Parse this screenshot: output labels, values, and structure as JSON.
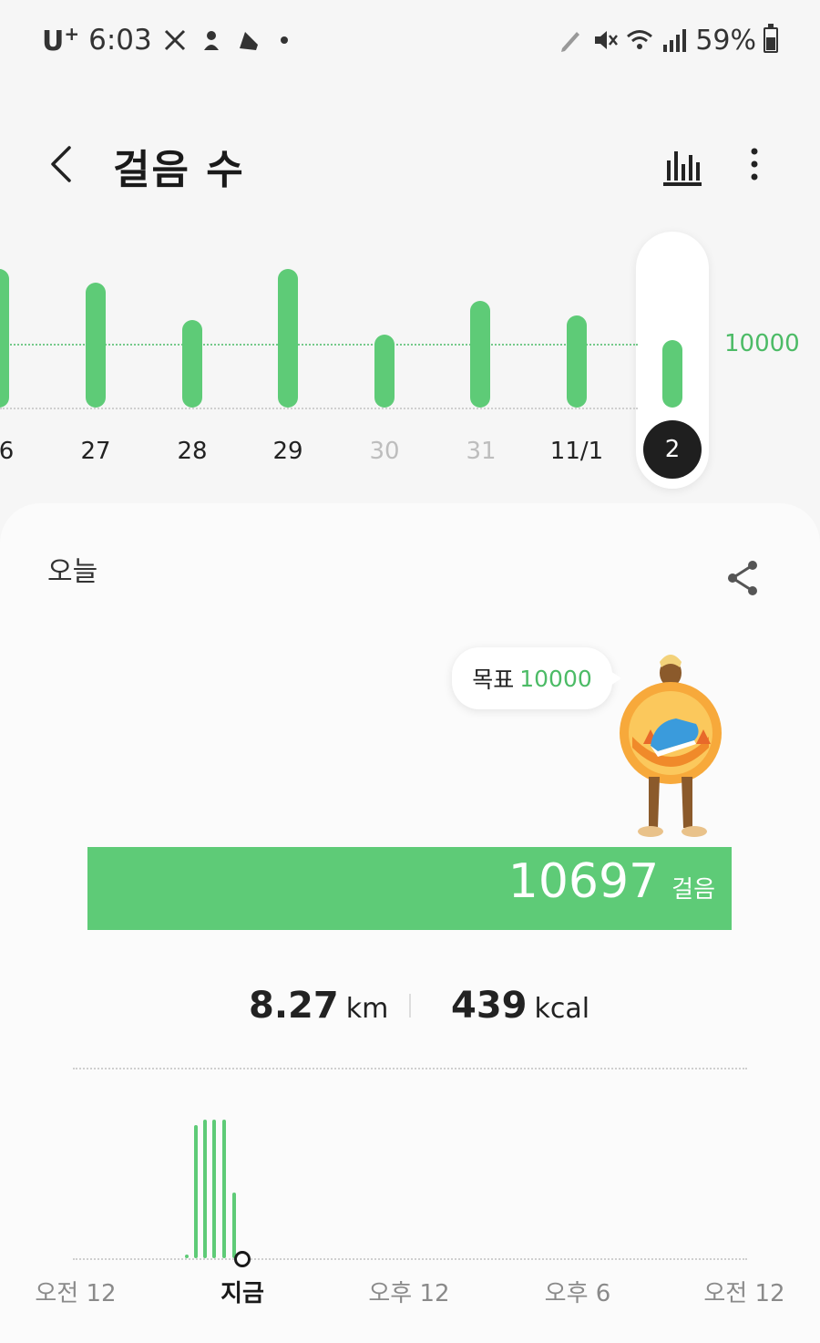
{
  "status": {
    "carrier": "U",
    "carrier_sup": "+",
    "time": "6:03",
    "battery": "59%",
    "icons_left": [
      "missed-call-icon",
      "app-notification-icon",
      "shoe-icon",
      "dot-icon"
    ],
    "icons_right": [
      "pencil-icon",
      "mute-icon",
      "wifi-icon",
      "signal-icon",
      "battery-icon"
    ]
  },
  "header": {
    "title": "걸음 수",
    "icons": [
      "back-icon",
      "bar-chart-icon",
      "more-icon"
    ]
  },
  "weekly": {
    "goal_label": "10000",
    "days": [
      {
        "label": "6",
        "dim": false
      },
      {
        "label": "27",
        "dim": false
      },
      {
        "label": "28",
        "dim": false
      },
      {
        "label": "29",
        "dim": false
      },
      {
        "label": "30",
        "dim": true
      },
      {
        "label": "31",
        "dim": true
      },
      {
        "label": "11/1",
        "dim": false
      },
      {
        "label": "2",
        "selected": true
      }
    ]
  },
  "today": {
    "label": "오늘",
    "goal_label": "목표",
    "goal_value": "10000",
    "steps": "10697",
    "steps_unit": "걸음",
    "distance": "8.27",
    "distance_unit": "km",
    "calories": "439",
    "calories_unit": "kcal"
  },
  "daily": {
    "labels": [
      "오전 12",
      "지금",
      "오후 12",
      "오후 6",
      "오전 12"
    ]
  },
  "colors": {
    "accent": "#5ecb77",
    "accent_text": "#4cbb66",
    "selected_date_bg": "#1f1f1f"
  }
}
